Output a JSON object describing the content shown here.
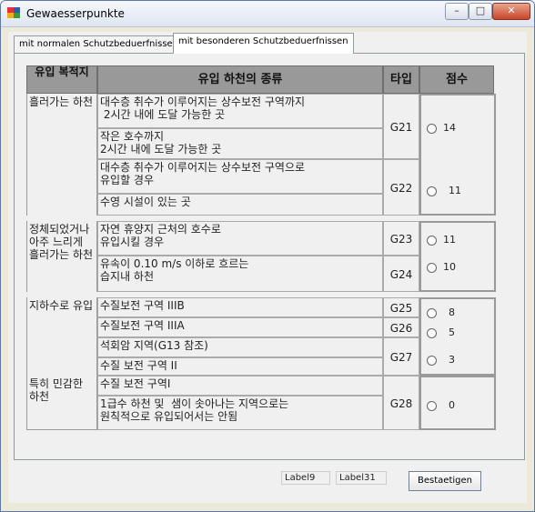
{
  "window": {
    "title": "Gewaesserpunkte",
    "minimize": "–",
    "maximize": "□",
    "close": "✕"
  },
  "tabs": [
    "mit normalen Schutzbeduerfnissen",
    "mit besonderen Schutzbeduerfnissen"
  ],
  "table": {
    "headers": {
      "col1": "유입 복적지",
      "col2": "유입 하천의 종류",
      "col3": "타입",
      "col4": "점수"
    },
    "categories": {
      "c1": "흘러가는 하천",
      "c2": "정체되었거나 아주 느리게 흘러가는 하천",
      "c3": "지하수로 유입",
      "c4": "특히 민감한 하천"
    },
    "rows": {
      "r1": "대수층 취수가 이루어지는 상수보전 구역까지\n 2시간 내에 도달 가능한 곳",
      "r2": "작은 호수까지\n2시간 내에 도달 가능한 곳",
      "r3": "대수층 취수가 이루어지는 상수보전 구역으로\n유입할 경우",
      "r4": "수영 시설이 있는 곳",
      "r5": "자연 휴양지 근처의 호수로\n유입시킬 경우",
      "r6": "유속이 0.10 m/s 이하로 흐르는\n습지내 하천",
      "r7": "수질보전 구역 IIIB",
      "r8": "수질보전 구역 IIIA",
      "r9": "석회암 지역(G13 참조)",
      "r10": "수질 보전 구역 II",
      "r11": "수질 보전 구역I",
      "r12": "1급수 하천 및  샘이 솟아나는 지역으로는\n원칙적으로 유입되어서는 안됨"
    },
    "codes": [
      "G21",
      "G22",
      "G23",
      "G24",
      "G25",
      "G26",
      "G27",
      "G28"
    ],
    "scores": [
      "14",
      "11",
      "11",
      "10",
      "8",
      "5",
      "3",
      "0"
    ]
  },
  "footer": {
    "label9": "Label9",
    "label31": "Label31",
    "confirm": "Bestaetigen"
  }
}
